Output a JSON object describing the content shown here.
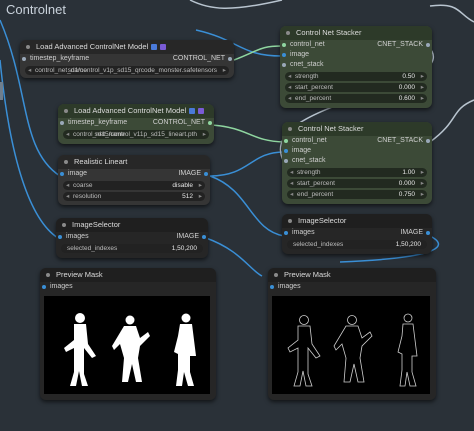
{
  "group": {
    "title": "Controlnet"
  },
  "colors": {
    "wire_blue": "#3a8fd6",
    "wire_green": "#8fd6a0",
    "wire_gray": "#b8c4cf",
    "node_green": "#3c4a37"
  },
  "nodes": {
    "load_cn_1": {
      "title": "Load Advanced ControlNet Model",
      "slot_in": "timestep_keyframe",
      "slot_out": "CONTROL_NET",
      "widget_label": "control_net_name",
      "widget_value": "sd1/control_v1p_sd15_qrcode_monster.safetensors"
    },
    "load_cn_2": {
      "title": "Load Advanced ControlNet Model",
      "slot_in": "timestep_keyframe",
      "slot_out": "CONTROL_NET",
      "widget_label": "control_net_name",
      "widget_value": "sd15/control_v11p_sd15_lineart.pth"
    },
    "stacker_1": {
      "title": "Control Net Stacker",
      "inputs": [
        "control_net",
        "image",
        "cnet_stack"
      ],
      "output": "CNET_STACK",
      "widgets": [
        {
          "label": "strength",
          "value": "0.50"
        },
        {
          "label": "start_percent",
          "value": "0.000"
        },
        {
          "label": "end_percent",
          "value": "0.600"
        }
      ]
    },
    "stacker_2": {
      "title": "Control Net Stacker",
      "inputs": [
        "control_net",
        "image",
        "cnet_stack"
      ],
      "output": "CNET_STACK",
      "widgets": [
        {
          "label": "strength",
          "value": "1.00"
        },
        {
          "label": "start_percent",
          "value": "0.000"
        },
        {
          "label": "end_percent",
          "value": "0.750"
        }
      ]
    },
    "lineart": {
      "title": "Realistic Lineart",
      "slot_in": "image",
      "slot_out": "IMAGE",
      "widgets": [
        {
          "label": "coarse",
          "value": "disable"
        },
        {
          "label": "resolution",
          "value": "512"
        }
      ]
    },
    "selector_1": {
      "title": "ImageSelector",
      "slot_in": "images",
      "slot_out": "IMAGE",
      "widget_label": "selected_indexes",
      "widget_value": "1,50,200"
    },
    "selector_2": {
      "title": "ImageSelector",
      "slot_in": "images",
      "slot_out": "IMAGE",
      "widget_label": "selected_indexes",
      "widget_value": "1,50,200"
    },
    "preview_1": {
      "title": "Preview Mask",
      "slot_in": "images"
    },
    "preview_2": {
      "title": "Preview Mask",
      "slot_in": "images"
    }
  }
}
